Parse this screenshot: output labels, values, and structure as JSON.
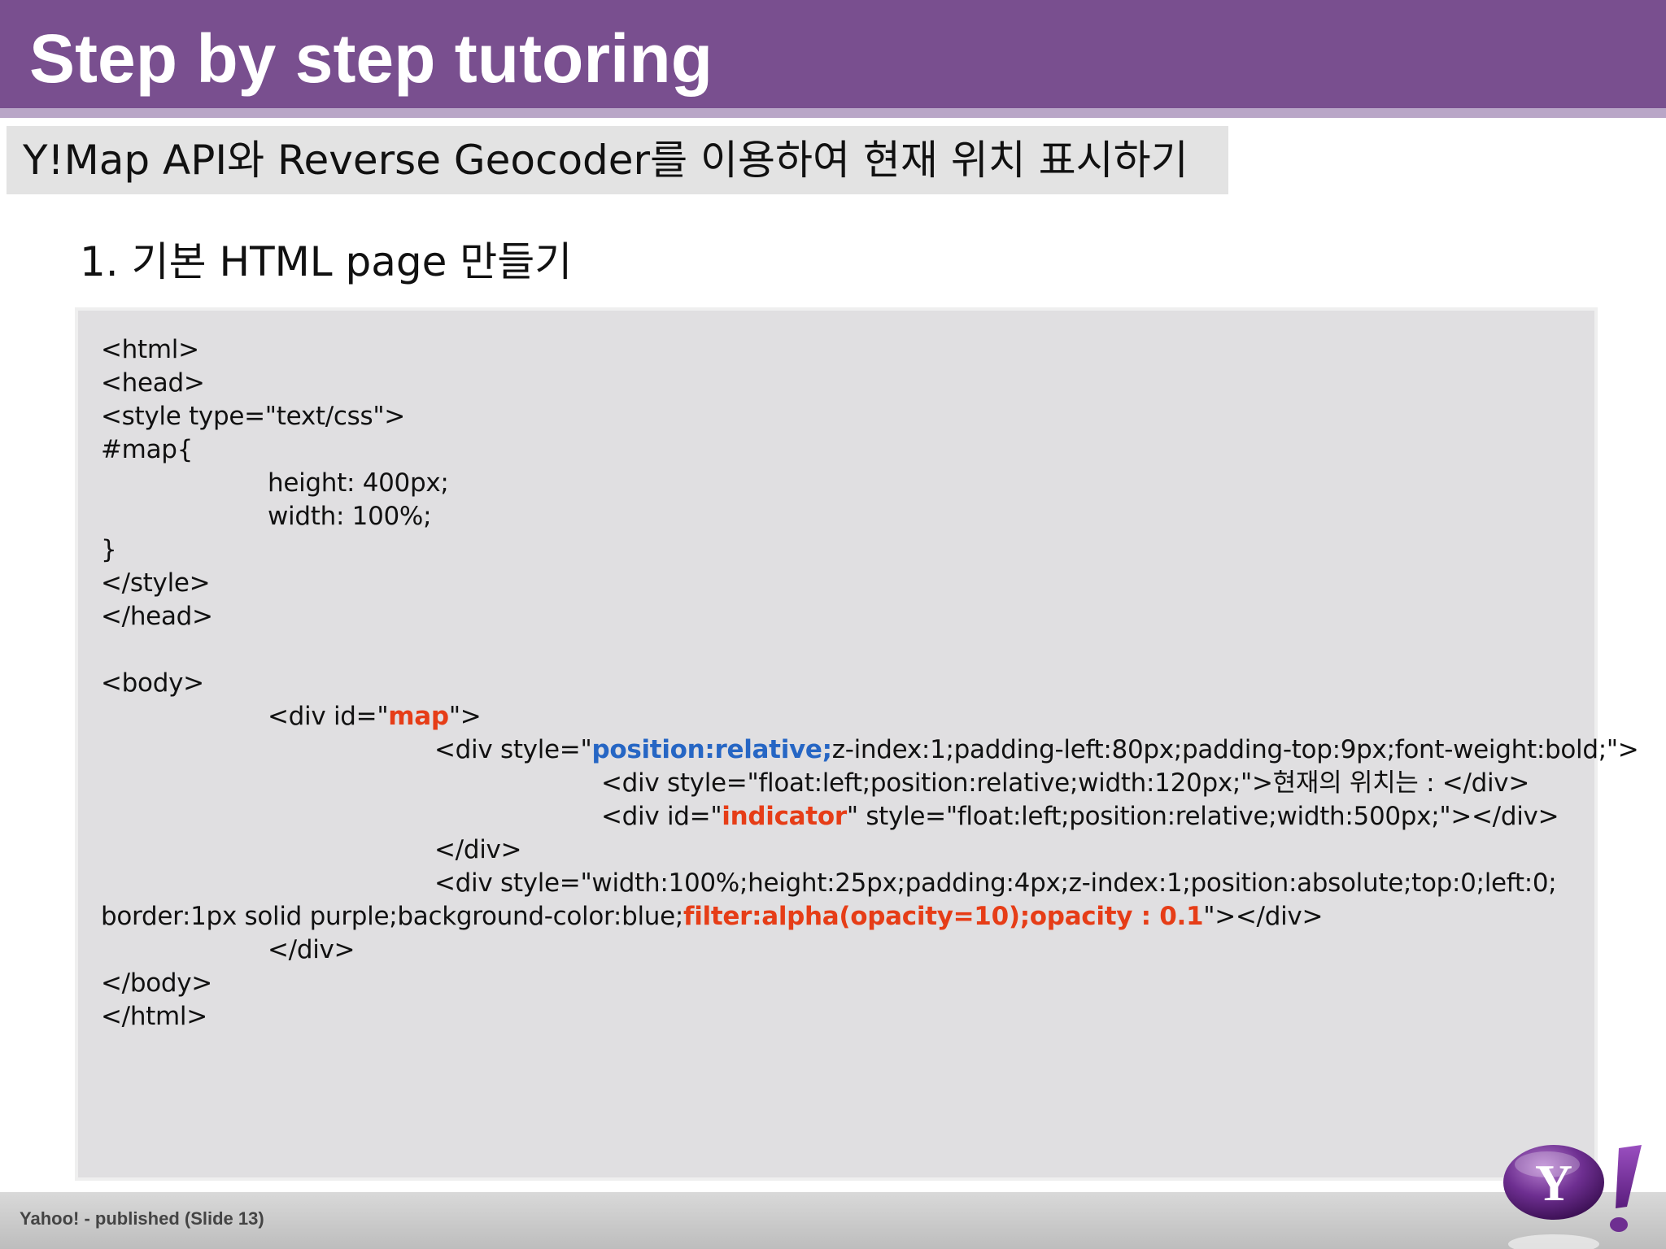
{
  "slide": {
    "title": "Step by step tutoring",
    "subtitle": "Y!Map API와 Reverse Geocoder를 이용하여 현재 위치 표시하기",
    "section_heading": "1. 기본 HTML page 만들기",
    "footer": "Yahoo! - published (Slide 13)"
  },
  "code": {
    "l1": "<html>",
    "l2": "<head>",
    "l3": "<style type=\"text/css\">",
    "l4": "#map{",
    "l5": "height: 400px;",
    "l6": "width: 100%;",
    "l7": "}",
    "l8": "</style>",
    "l9": "</head>",
    "l10": "<body>",
    "l11_a": "<div id=\"",
    "l11_b": "map",
    "l11_c": "\">",
    "l12_a": "<div style=\"",
    "l12_b": "position:relative;",
    "l12_c": "z-index:1;padding-left:80px;padding-top:9px;font-weight:bold;\">",
    "l13": "<div style=\"float:left;position:relative;width:120px;\">현재의 위치는 : </div>",
    "l14_a": "<div id=\"",
    "l14_b": "indicator",
    "l14_c": "\" style=\"float:left;position:relative;width:500px;\"></div>",
    "l15": "</div>",
    "l16": "<div style=\"width:100%;height:25px;padding:4px;z-index:1;position:absolute;top:0;left:0;",
    "l17_a": "border:1px solid purple;background-color:blue;",
    "l17_b": "filter:alpha(opacity=10);opacity : 0.1",
    "l17_c": "\"></div>",
    "l18": "</div>",
    "l19": "</body>",
    "l20": "</html>"
  },
  "logo": {
    "icon": "yahoo-logo-icon",
    "text": "Y!"
  },
  "colors": {
    "title_bar": "#794f8f",
    "highlight_red": "#e63d17",
    "highlight_blue": "#2666c4",
    "code_background": "#e0dfe1"
  }
}
